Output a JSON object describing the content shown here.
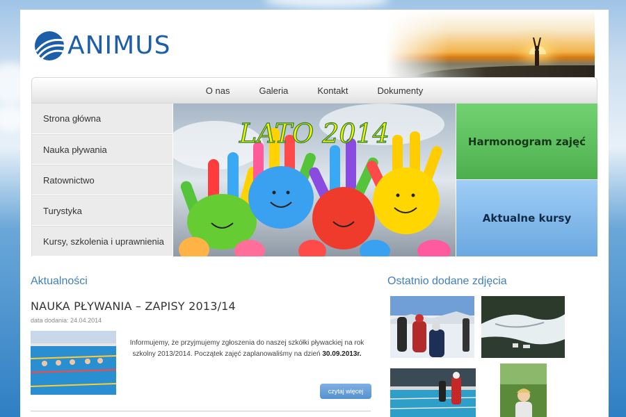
{
  "header": {
    "logo_text": "ANIMUS"
  },
  "nav": {
    "items": [
      "O nas",
      "Galeria",
      "Kontakt",
      "Dokumenty"
    ]
  },
  "sidemenu": {
    "items": [
      "Strona główna",
      "Nauka pływania",
      "Ratownictwo",
      "Turystyka",
      "Kursy, szkolenia i uprawnienia"
    ]
  },
  "banner": {
    "text": "LATO 2014"
  },
  "tiles": {
    "schedule": "Harmonogram zajęć",
    "courses": "Aktualne kursy"
  },
  "news": {
    "section_title": "Aktualności",
    "title": "NAUKA PŁYWANIA – ZAPISY 2013/14",
    "date": "data dodania: 24.04.2014",
    "body_prefix": "Informujemy, że przyjmujemy zgłoszenia do naszej szkółki pływackiej na rok szkolny 2013/2014. Początek zajęć zaplanowaliśmy na dzień ",
    "body_bold": "30.09.2013r.",
    "more": "czytaj więcej"
  },
  "photos": {
    "section_title": "Ostatnio dodane zdjęcia"
  },
  "colors": {
    "brand": "#1c5ea8",
    "accent_green": "#4caf4c",
    "accent_blue": "#6aa8e0",
    "section_title": "#3f7fc0"
  }
}
